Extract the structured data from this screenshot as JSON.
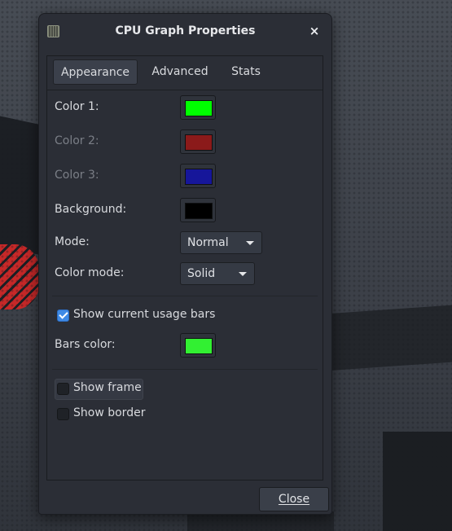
{
  "window": {
    "title": "CPU Graph Properties",
    "close_glyph": "×",
    "app_icon": "cpu-graph-icon"
  },
  "tabs": [
    {
      "label": "Appearance",
      "active": true
    },
    {
      "label": "Advanced",
      "active": false
    },
    {
      "label": "Stats",
      "active": false
    }
  ],
  "appearance": {
    "color1": {
      "label": "Color 1:",
      "color": "#00ff00",
      "enabled": true
    },
    "color2": {
      "label": "Color 2:",
      "color": "#8b1a1a",
      "enabled": false
    },
    "color3": {
      "label": "Color 3:",
      "color": "#16169a",
      "enabled": false
    },
    "background": {
      "label": "Background:",
      "color": "#000000",
      "enabled": true
    },
    "mode": {
      "label": "Mode:",
      "value": "Normal"
    },
    "color_mode": {
      "label": "Color mode:",
      "value": "Solid"
    },
    "show_usage_bars": {
      "label": "Show current usage bars",
      "checked": true
    },
    "bars_color": {
      "label": "Bars color:",
      "color": "#32f032"
    },
    "show_frame": {
      "label": "Show frame",
      "checked": false
    },
    "show_border": {
      "label": "Show border",
      "checked": false
    }
  },
  "buttons": {
    "close_label": "Close"
  },
  "theme": {
    "accent": "#3f8ae5",
    "window_bg": "#2b2e36"
  }
}
